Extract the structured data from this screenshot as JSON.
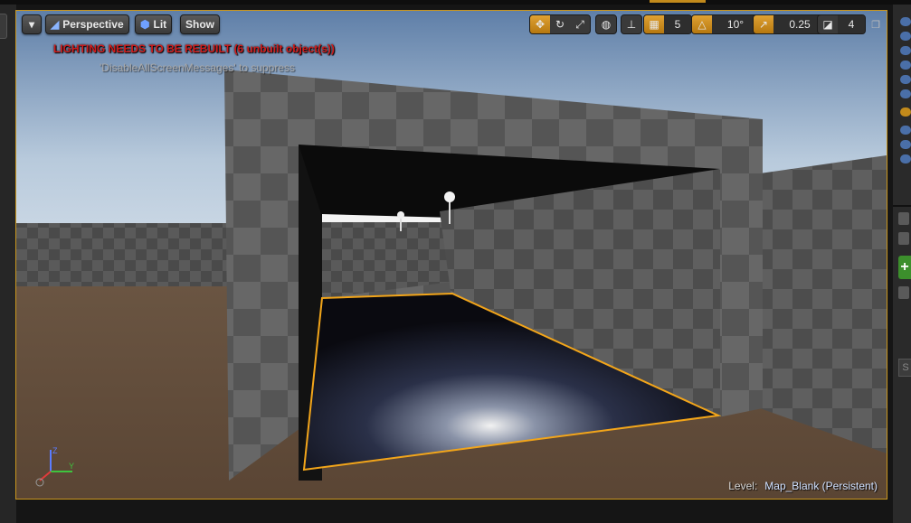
{
  "toolbar": {
    "view_mode": "Perspective",
    "lighting_mode": "Lit",
    "show_label": "Show",
    "grid_snap_value": "5",
    "rotation_snap_value": "10°",
    "scale_snap_value": "0.25",
    "camera_speed_value": "4"
  },
  "messages": {
    "warning": "LIGHTING NEEDS TO BE REBUILT (6 unbuilt object(s))",
    "hint": "'DisableAllScreenMessages' to suppress"
  },
  "status": {
    "level_label": "Level:",
    "level_name": "Map_Blank (Persistent)"
  },
  "right_panel": {
    "search_placeholder": "S"
  },
  "icons": {
    "dropdown": "chevron-down-icon",
    "perspective": "perspective-icon",
    "lit": "lit-sphere-icon",
    "translate": "translate-icon",
    "rotate": "rotate-icon",
    "scale": "scale-icon",
    "world": "globe-icon",
    "surface_snap": "surface-snap-icon",
    "grid": "grid-icon",
    "angle": "angle-icon",
    "scale_snap": "scale-snap-icon",
    "camera": "camera-speed-icon",
    "maximize": "maximize-icon"
  },
  "colors": {
    "accent": "#c9961e",
    "warning": "#d21c1c",
    "selection_outline": "#f2a51a"
  }
}
